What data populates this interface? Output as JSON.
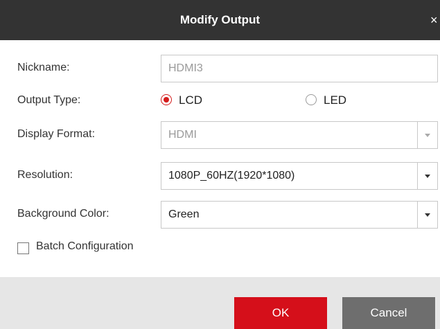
{
  "dialog": {
    "title": "Modify Output",
    "close_glyph": "×"
  },
  "form": {
    "nickname": {
      "label": "Nickname:",
      "value": "HDMI3"
    },
    "output_type": {
      "label": "Output Type:",
      "options": [
        {
          "label": "LCD",
          "selected": true
        },
        {
          "label": "LED",
          "selected": false
        }
      ]
    },
    "display_format": {
      "label": "Display Format:",
      "value": "HDMI"
    },
    "resolution": {
      "label": "Resolution:",
      "value": "1080P_60HZ(1920*1080)"
    },
    "background_color": {
      "label": "Background Color:",
      "value": "Green"
    },
    "batch_configuration": {
      "label": "Batch Configuration",
      "checked": false
    }
  },
  "buttons": {
    "ok": "OK",
    "cancel": "Cancel"
  },
  "colors": {
    "titlebar": "#333333",
    "accent": "#d50f1a",
    "cancel": "#6e6e6e",
    "footer": "#e6e6e6"
  },
  "icons": [
    "close-icon",
    "chevron-down-icon",
    "radio-icon",
    "checkbox-icon"
  ]
}
